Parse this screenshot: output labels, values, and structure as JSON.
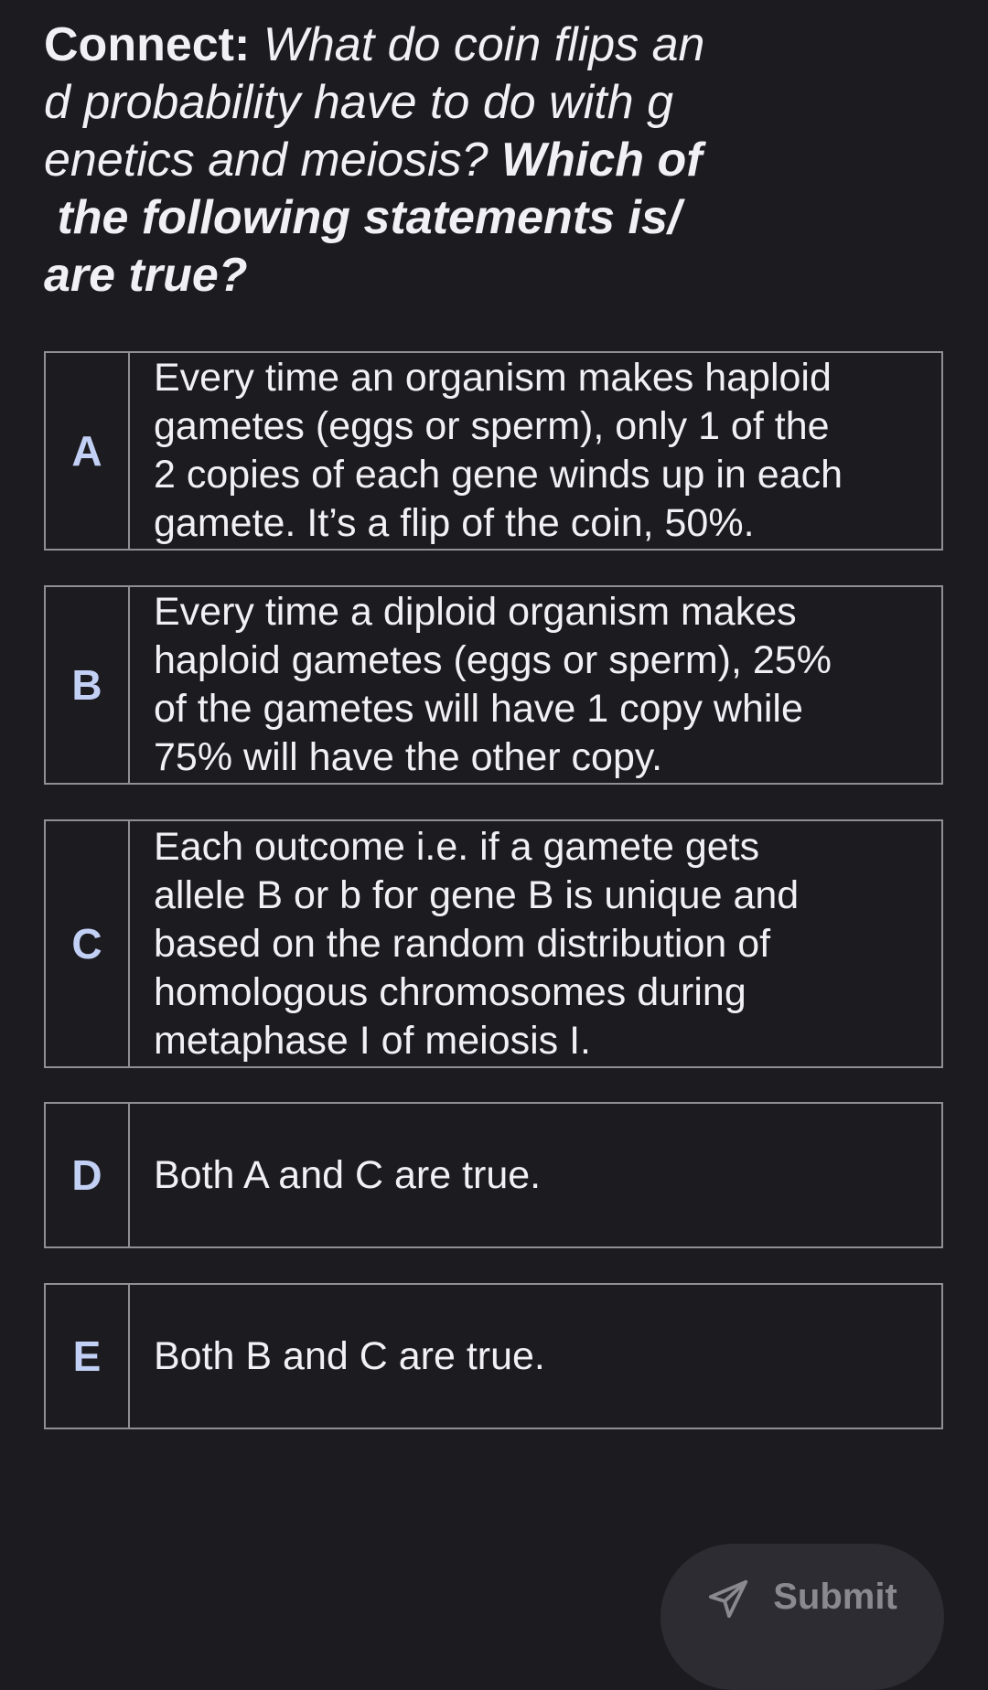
{
  "question": {
    "label": "Connect:",
    "body": " What do coin flips an\nd probability have to do with g\nenetics and meiosis? ",
    "emphasis": "Which of\n the following statements is/\nare true?"
  },
  "options": [
    {
      "letter": "A",
      "text": "Every time an organism makes haploid\ngametes (eggs or sperm), only 1 of the\n2 copies of each gene winds up in each\ngamete. It’s a flip of the coin, 50%."
    },
    {
      "letter": "B",
      "text": "Every time a diploid organism makes\nhaploid gametes (eggs or sperm), 25%\nof the gametes will have 1 copy while\n75% will have the other copy."
    },
    {
      "letter": "C",
      "text": "Each outcome i.e. if a gamete gets\nallele B or b for gene B is unique and\nbased on the random distribution of\nhomologous chromosomes during\nmetaphase I of meiosis I."
    },
    {
      "letter": "D",
      "text": "Both A and C are true."
    },
    {
      "letter": "E",
      "text": "Both B and C are true."
    }
  ],
  "submit": {
    "label": "Submit",
    "icon": "send-icon"
  },
  "colors": {
    "background": "#1c1b20",
    "text": "#f1f0f4",
    "letter": "#c3d0f5",
    "border": "#8f8f95",
    "submit_bg": "#2d2c32",
    "submit_text": "#8a898f"
  }
}
